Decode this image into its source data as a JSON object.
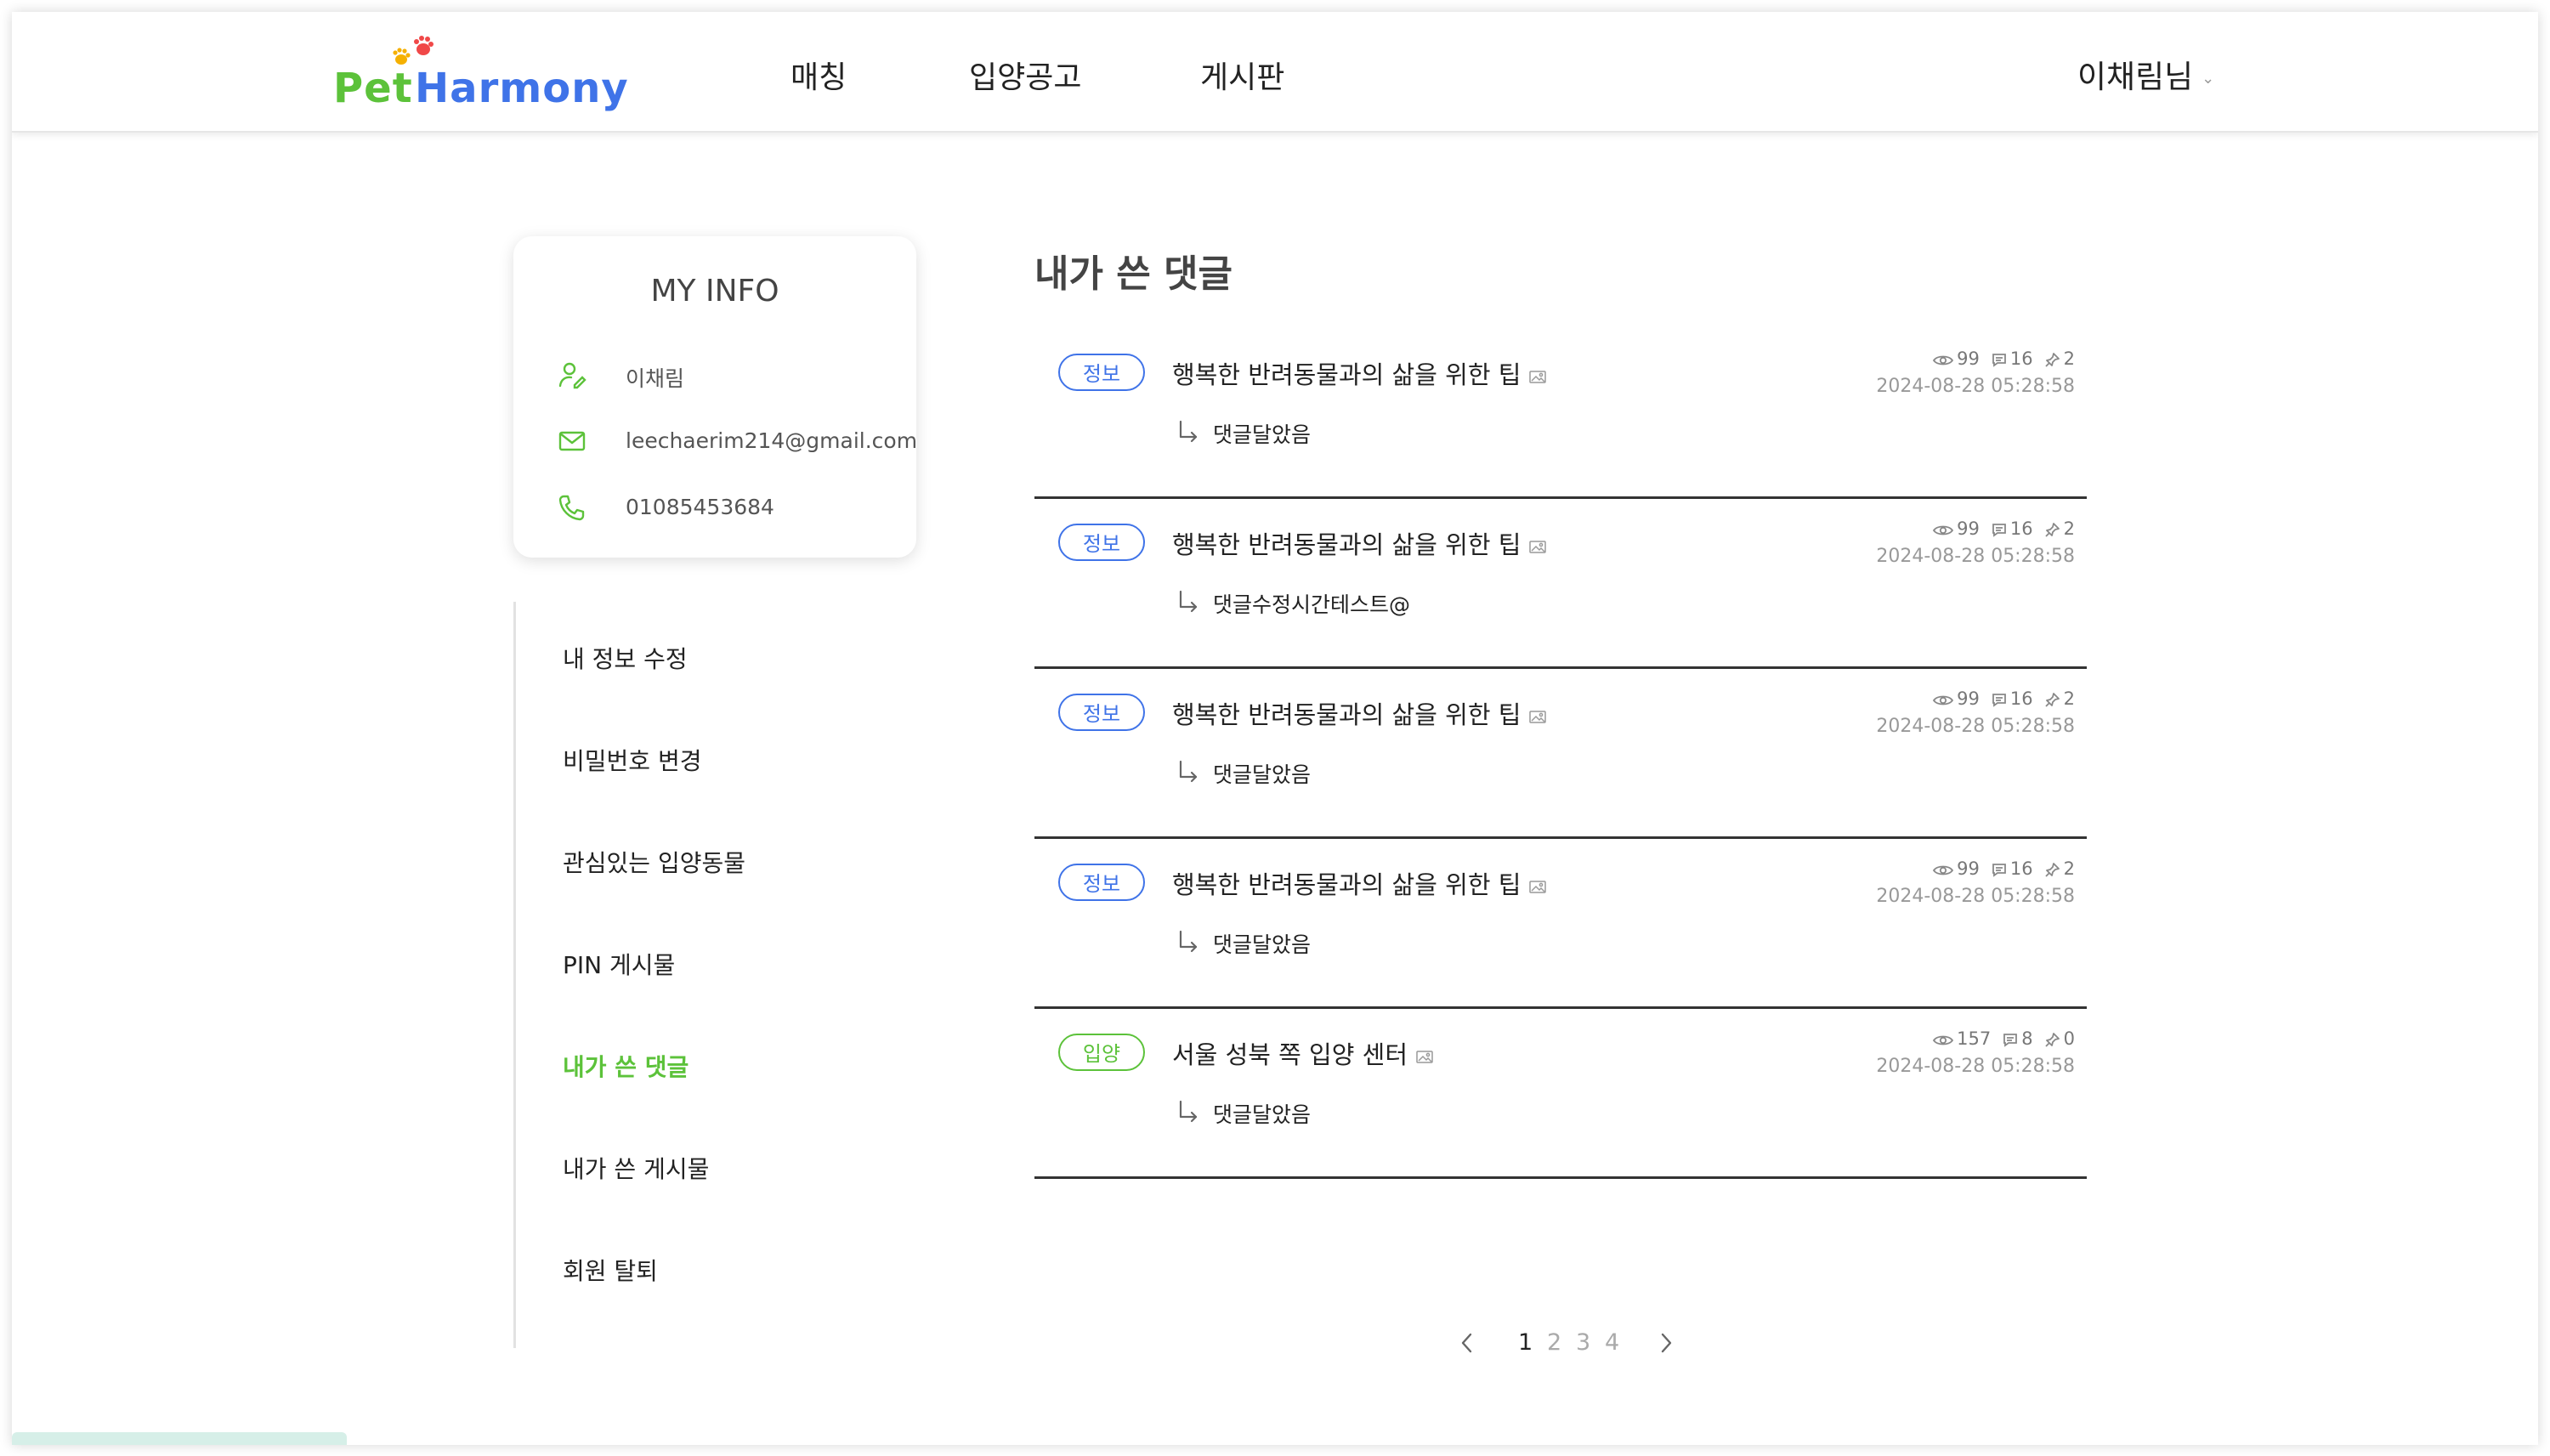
{
  "header": {
    "logo": {
      "pet": "Pet",
      "harmony": "Harmony"
    },
    "nav": [
      "매칭",
      "입양공고",
      "게시판"
    ],
    "user_label": "이채림님"
  },
  "info_card": {
    "title": "MY INFO",
    "name": "이채림",
    "email": "leechaerim214@gmail.com",
    "phone": "01085453684"
  },
  "side_menu": {
    "items": [
      "내 정보 수정",
      "비밀번호 변경",
      "관심있는 입양동물",
      "PIN 게시물",
      "내가 쓴 댓글",
      "내가 쓴 게시물",
      "회원 탈퇴"
    ],
    "active_index": 4
  },
  "main": {
    "title": "내가 쓴 댓글",
    "comments": [
      {
        "category": "정보",
        "post_title": "행복한 반려동물과의 삶을 위한 팁",
        "reply": "댓글달았음",
        "views": "99",
        "comments": "16",
        "pins": "2",
        "date": "2024-08-28 05:28:58"
      },
      {
        "category": "정보",
        "post_title": "행복한 반려동물과의 삶을 위한 팁",
        "reply": "댓글수정시간테스트@",
        "views": "99",
        "comments": "16",
        "pins": "2",
        "date": "2024-08-28 05:28:58"
      },
      {
        "category": "정보",
        "post_title": "행복한 반려동물과의 삶을 위한 팁",
        "reply": "댓글달았음",
        "views": "99",
        "comments": "16",
        "pins": "2",
        "date": "2024-08-28 05:28:58"
      },
      {
        "category": "정보",
        "post_title": "행복한 반려동물과의 삶을 위한 팁",
        "reply": "댓글달았음",
        "views": "99",
        "comments": "16",
        "pins": "2",
        "date": "2024-08-28 05:28:58"
      },
      {
        "category": "입양",
        "post_title": "서울 성북 쪽 입양 센터",
        "reply": "댓글달았음",
        "views": "157",
        "comments": "8",
        "pins": "0",
        "date": "2024-08-28 05:28:58"
      }
    ]
  },
  "pagination": {
    "pages": [
      "1",
      "2",
      "3",
      "4"
    ],
    "current": "1"
  },
  "colors": {
    "brand_green": "#5cc23a",
    "brand_blue": "#3f73e8"
  }
}
